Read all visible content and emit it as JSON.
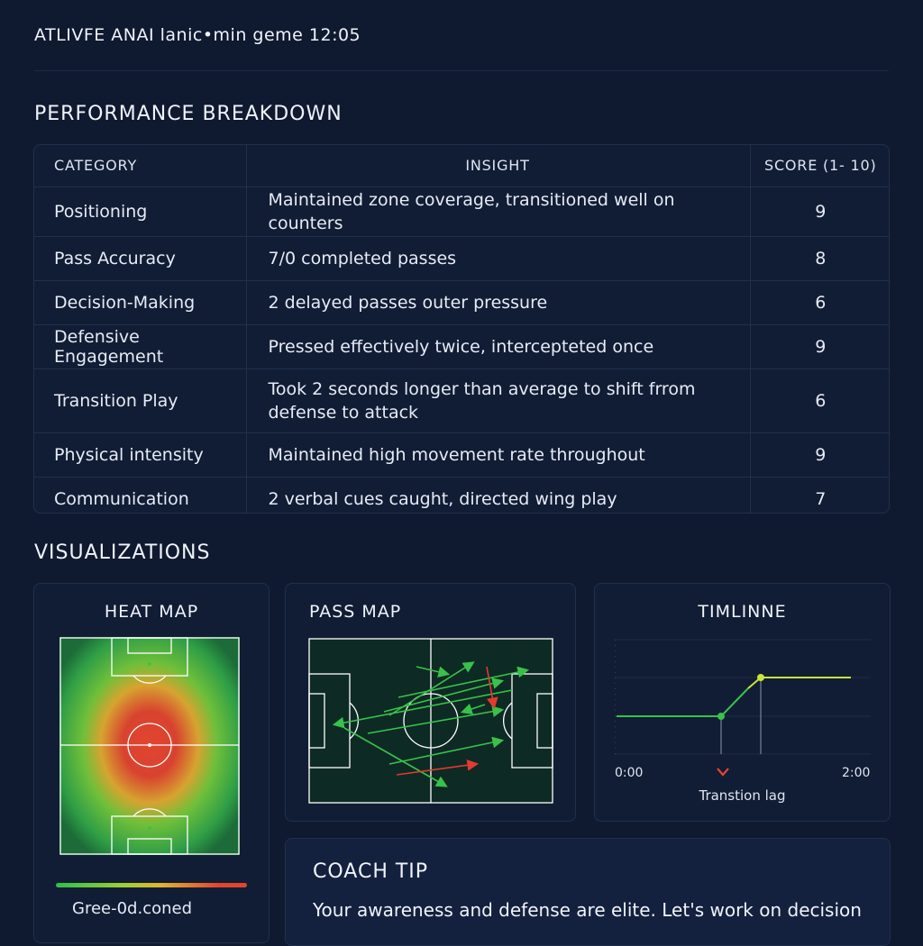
{
  "header": {
    "title": "ATLIVFE ANAI lanic•min   geme 12:05"
  },
  "performance": {
    "title": "PERFORMANCE BREAKDOWN",
    "columns": [
      "CATEGORY",
      "INSIGHT",
      "SCORE (1- 10)"
    ],
    "rows": [
      {
        "category": "Positioning",
        "insight": "Maintained zone coverage, transitioned well on counters",
        "score": "9"
      },
      {
        "category": "Pass Accuracy",
        "insight": "7/0 completed passes",
        "score": "8"
      },
      {
        "category": "Decision-Making",
        "insight": "2 delayed passes outer pressure",
        "score": "6"
      },
      {
        "category": "Defensive Engagement",
        "insight": "Pressed effectively twice, intercepteted once",
        "score": "9"
      },
      {
        "category": "Transition Play",
        "insight": "Took 2 seconds longer than average to shift frrom defense to attack",
        "score": "6"
      },
      {
        "category": "Physical intensity",
        "insight": "Maintained high movement rate throughout",
        "score": "9"
      },
      {
        "category": "Communication",
        "insight": "2 verbal cues caught, directed wing play",
        "score": "7"
      }
    ]
  },
  "visualizations": {
    "title": "VISUALIZATIONS",
    "heatmap": {
      "title": "HEAT MAP",
      "legend_label": "Gree-0d.coned",
      "hot_color": "#e2452f",
      "cool_color": "#2fbf4a"
    },
    "passmap": {
      "title": "PASS MAP",
      "complete_color": "#38c24a",
      "failed_color": "#e23b2f"
    },
    "timeline": {
      "title": "TIMLINNE",
      "start_label": "0:00",
      "end_label": "2:00",
      "marker_label": "Transtion lag",
      "marker_icon": "chevron-down-icon",
      "line_color": "#38c24a",
      "highlight_color": "#c8e63a"
    }
  },
  "coach_tip": {
    "title": "COACH TIP",
    "body": "Your awareness and defense are elite. Let's work on decision"
  }
}
